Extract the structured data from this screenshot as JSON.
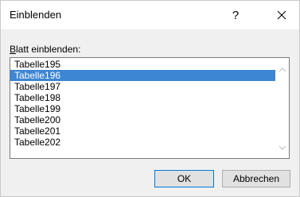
{
  "dialog": {
    "title": "Einblenden",
    "help_label": "?",
    "sheet_label_mnemonic": "B",
    "sheet_label_rest": "latt einblenden:",
    "sheets": [
      "Tabelle195",
      "Tabelle196",
      "Tabelle197",
      "Tabelle198",
      "Tabelle199",
      "Tabelle200",
      "Tabelle201",
      "Tabelle202"
    ],
    "selected_sheet": "Tabelle196",
    "ok_label": "OK",
    "cancel_label": "Abbrechen"
  },
  "icons": {
    "help": "question-mark-icon",
    "close": "close-icon",
    "scroll_up": "chevron-up-icon",
    "scroll_down": "chevron-down-icon"
  },
  "colors": {
    "selection": "#3d86d3",
    "dialog_bg": "#f0f0f0",
    "ok_border": "#0078d7"
  }
}
